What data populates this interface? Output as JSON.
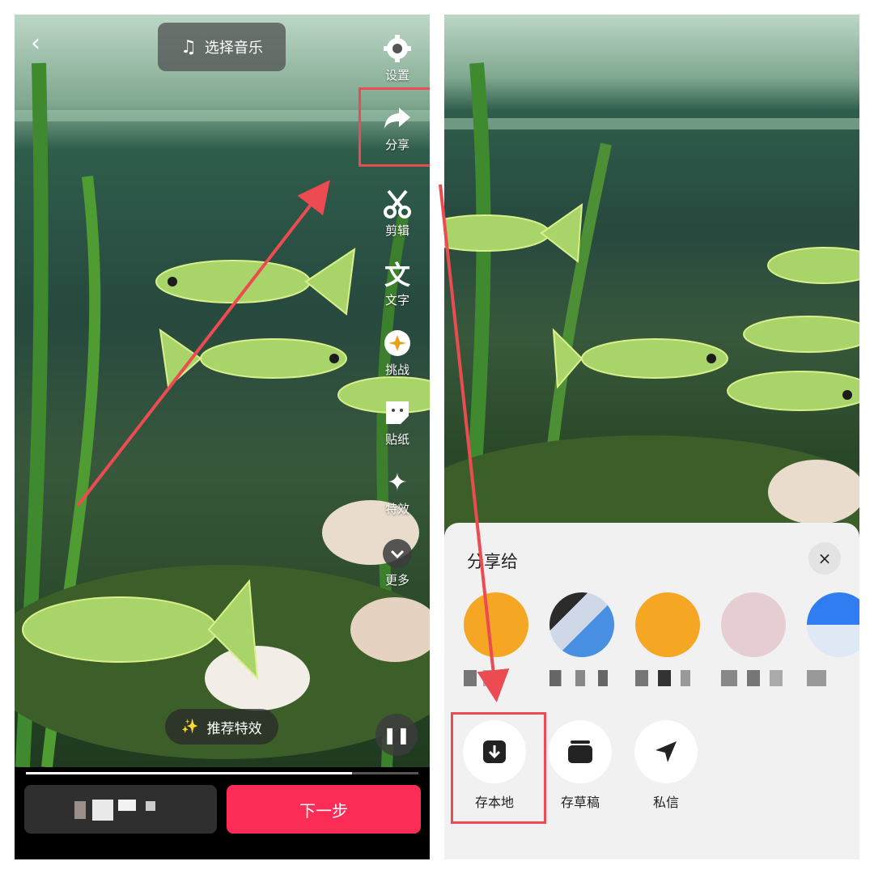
{
  "left_screen": {
    "music_pill": {
      "icon": "music-note-icon",
      "label": "选择音乐"
    },
    "tools": [
      {
        "icon": "gear-icon",
        "label": "设置"
      },
      {
        "icon": "share-arrow-icon",
        "label": "分享"
      },
      {
        "icon": "scissors-icon",
        "label": "剪辑"
      },
      {
        "icon": "text-icon",
        "label": "文字"
      },
      {
        "icon": "challenge-icon",
        "label": "挑战"
      },
      {
        "icon": "sticker-icon",
        "label": "贴纸"
      },
      {
        "icon": "sparkle-icon",
        "label": "特效"
      },
      {
        "icon": "chevron-down-icon",
        "label": "更多"
      }
    ],
    "recommend_effect": "推荐特效",
    "progress_fraction": 0.83,
    "next_label": "下一步"
  },
  "right_screen": {
    "share_sheet": {
      "title": "分享给",
      "close": "×",
      "actions": [
        {
          "icon": "download-icon",
          "label": "存本地"
        },
        {
          "icon": "drafts-icon",
          "label": "存草稿"
        },
        {
          "icon": "send-icon",
          "label": "私信"
        }
      ]
    }
  },
  "colors": {
    "accent": "#fb2c55",
    "annotation": "#ec4b52",
    "sheet_bg": "#f1f1f1"
  }
}
